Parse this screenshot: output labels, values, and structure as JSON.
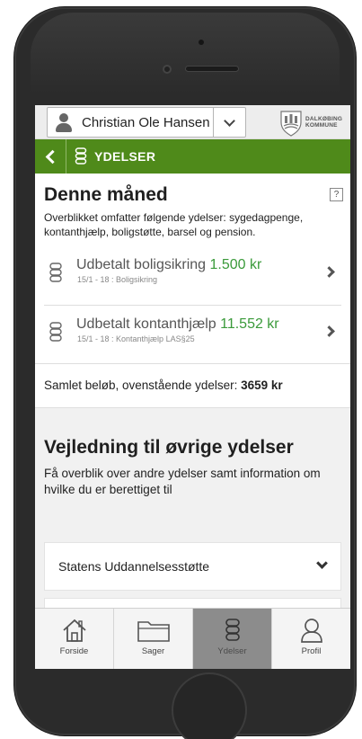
{
  "header": {
    "user_name": "Christian Ole Hansen",
    "kommune_line1": "DALKØBING",
    "kommune_line2": "KOMMUNE"
  },
  "nav": {
    "title": "YDELSER",
    "color": "#4f8a1a"
  },
  "month": {
    "title": "Denne måned",
    "help": "?",
    "description": "Overblikket omfatter følgende ydelser: sygedagpenge, kontanthjælp, boligstøtte, barsel og pension."
  },
  "benefits": [
    {
      "label": "Udbetalt boligsikring",
      "amount": "1.500 kr",
      "sub": "15/1 - 18 : Boligsikring"
    },
    {
      "label": "Udbetalt kontanthjælp",
      "amount": "11.552 kr",
      "sub": "15/1 - 18 : Kontanthjælp LAS§25"
    }
  ],
  "total": {
    "label": "Samlet beløb, ovenstående ydelser:",
    "value": "3659 kr"
  },
  "guide": {
    "title": "Vejledning til øvrige ydelser",
    "description": "Få overblik over andre ydelser samt information om hvilke du er berettiget til",
    "items": [
      "Statens Uddannelsesstøtte"
    ]
  },
  "tabs": [
    {
      "label": "Forside",
      "icon": "home-icon"
    },
    {
      "label": "Sager",
      "icon": "folder-icon"
    },
    {
      "label": "Ydelser",
      "icon": "coins-icon",
      "active": true
    },
    {
      "label": "Profil",
      "icon": "person-icon"
    }
  ]
}
